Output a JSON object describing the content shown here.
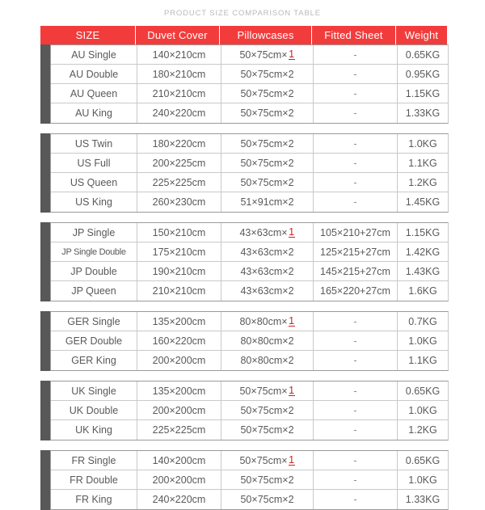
{
  "title": "PRODUCT SIZE COMPARISON TABLE",
  "colors": {
    "header_red": "#f23c3c",
    "group_tab_gray": "#585858",
    "text_gray": "#595959",
    "title_gray": "#b9b9b9",
    "qty_red": "#d01e1e",
    "border_gray": "#c9c9c9"
  },
  "table": {
    "columns": [
      {
        "key": "size",
        "label": "SIZE"
      },
      {
        "key": "duvet",
        "label": "Duvet  Cover"
      },
      {
        "key": "pillow",
        "label": "Pillowcases"
      },
      {
        "key": "fitted",
        "label": "Fitted Sheet"
      },
      {
        "key": "weight",
        "label": "Weight"
      }
    ],
    "groups": [
      {
        "region": "AU",
        "rows": [
          {
            "size": "AU Single",
            "duvet": "140×210cm",
            "pillow_base": "50×75cm×",
            "pillow_qty": "1",
            "pillow_qty_red": true,
            "fitted": "-",
            "weight": "0.65KG"
          },
          {
            "size": "AU Double",
            "duvet": "180×210cm",
            "pillow_base": "50×75cm×",
            "pillow_qty": "2",
            "pillow_qty_red": false,
            "fitted": "-",
            "weight": "0.95KG"
          },
          {
            "size": "AU Queen",
            "duvet": "210×210cm",
            "pillow_base": "50×75cm×",
            "pillow_qty": "2",
            "pillow_qty_red": false,
            "fitted": "-",
            "weight": "1.15KG"
          },
          {
            "size": "AU   King",
            "duvet": "240×220cm",
            "pillow_base": "50×75cm×",
            "pillow_qty": "2",
            "pillow_qty_red": false,
            "fitted": "-",
            "weight": "1.33KG"
          }
        ]
      },
      {
        "region": "US",
        "rows": [
          {
            "size": "US Twin",
            "duvet": "180×220cm",
            "pillow_base": "50×75cm×",
            "pillow_qty": "2",
            "pillow_qty_red": false,
            "fitted": "-",
            "weight": "1.0KG"
          },
          {
            "size": "US Full",
            "duvet": "200×225cm",
            "pillow_base": "50×75cm×",
            "pillow_qty": "2",
            "pillow_qty_red": false,
            "fitted": "-",
            "weight": "1.1KG"
          },
          {
            "size": "US Queen",
            "duvet": "225×225cm",
            "pillow_base": "50×75cm×",
            "pillow_qty": "2",
            "pillow_qty_red": false,
            "fitted": "-",
            "weight": "1.2KG"
          },
          {
            "size": "US King",
            "duvet": "260×230cm",
            "pillow_base": "51×91cm×",
            "pillow_qty": "2",
            "pillow_qty_red": false,
            "fitted": "-",
            "weight": "1.45KG"
          }
        ]
      },
      {
        "region": "JP",
        "rows": [
          {
            "size": "JP Single",
            "duvet": "150×210cm",
            "pillow_base": "43×63cm×",
            "pillow_qty": "1",
            "pillow_qty_red": true,
            "fitted": "105×210+27cm",
            "weight": "1.15KG"
          },
          {
            "size": "JP Single Double",
            "duvet": "175×210cm",
            "pillow_base": "43×63cm×",
            "pillow_qty": "2",
            "pillow_qty_red": false,
            "fitted": "125×215+27cm",
            "weight": "1.42KG",
            "condensed": true
          },
          {
            "size": "JP Double",
            "duvet": "190×210cm",
            "pillow_base": "43×63cm×",
            "pillow_qty": "2",
            "pillow_qty_red": false,
            "fitted": "145×215+27cm",
            "weight": "1.43KG"
          },
          {
            "size": "JP Queen",
            "duvet": "210×210cm",
            "pillow_base": "43×63cm×",
            "pillow_qty": "2",
            "pillow_qty_red": false,
            "fitted": "165×220+27cm",
            "weight": "1.6KG"
          }
        ]
      },
      {
        "region": "GER",
        "rows": [
          {
            "size": "GER Single",
            "duvet": "135×200cm",
            "pillow_base": "80×80cm×",
            "pillow_qty": "1",
            "pillow_qty_red": true,
            "fitted": "-",
            "weight": "0.7KG"
          },
          {
            "size": "GER Double",
            "duvet": "160×220cm",
            "pillow_base": "80×80cm×",
            "pillow_qty": "2",
            "pillow_qty_red": false,
            "fitted": "-",
            "weight": "1.0KG"
          },
          {
            "size": "GER King",
            "duvet": "200×200cm",
            "pillow_base": "80×80cm×",
            "pillow_qty": "2",
            "pillow_qty_red": false,
            "fitted": "-",
            "weight": "1.1KG"
          }
        ]
      },
      {
        "region": "UK",
        "rows": [
          {
            "size": "UK Single",
            "duvet": "135×200cm",
            "pillow_base": "50×75cm×",
            "pillow_qty": "1",
            "pillow_qty_red": true,
            "fitted": "-",
            "weight": "0.65KG"
          },
          {
            "size": "UK Double",
            "duvet": "200×200cm",
            "pillow_base": "50×75cm×",
            "pillow_qty": "2",
            "pillow_qty_red": false,
            "fitted": "-",
            "weight": "1.0KG"
          },
          {
            "size": "UK King",
            "duvet": "225×225cm",
            "pillow_base": "50×75cm×",
            "pillow_qty": "2",
            "pillow_qty_red": false,
            "fitted": "-",
            "weight": "1.2KG"
          }
        ]
      },
      {
        "region": "FR",
        "rows": [
          {
            "size": "FR Single",
            "duvet": "140×200cm",
            "pillow_base": "50×75cm×",
            "pillow_qty": "1",
            "pillow_qty_red": true,
            "fitted": "-",
            "weight": "0.65KG"
          },
          {
            "size": "FR Double",
            "duvet": "200×200cm",
            "pillow_base": "50×75cm×",
            "pillow_qty": "2",
            "pillow_qty_red": false,
            "fitted": "-",
            "weight": "1.0KG"
          },
          {
            "size": "FR King",
            "duvet": "240×220cm",
            "pillow_base": "50×75cm×",
            "pillow_qty": "2",
            "pillow_qty_red": false,
            "fitted": "-",
            "weight": "1.33KG"
          }
        ]
      }
    ]
  }
}
